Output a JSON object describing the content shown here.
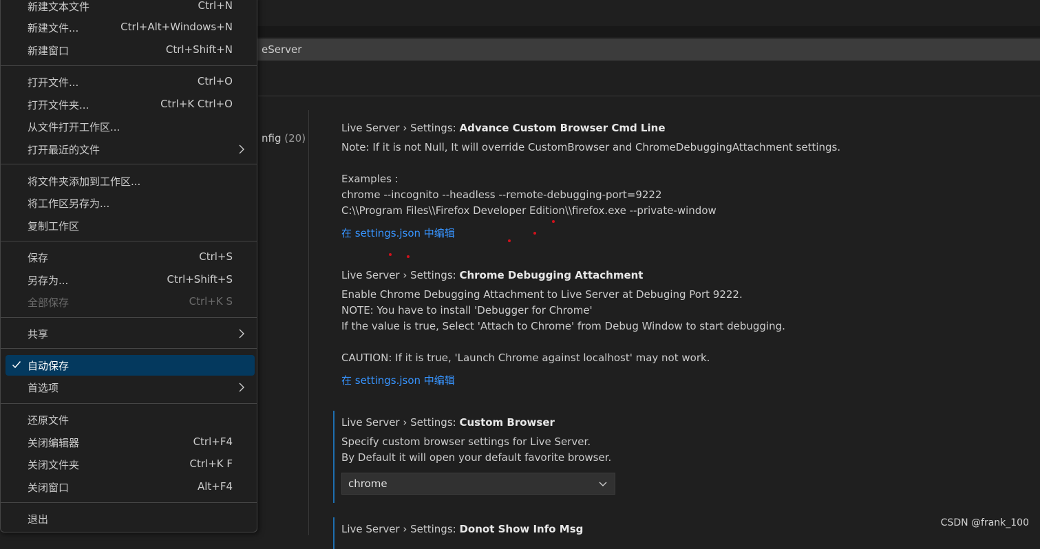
{
  "search": {
    "value_fragment": "eServer"
  },
  "toc": {
    "label_fragment": "nfig",
    "count": "(20)"
  },
  "settings": [
    {
      "category": "Live Server › Settings: ",
      "name": "Advance Custom Browser Cmd Line",
      "desc": [
        "Note: If it is not Null, It will override CustomBrowser and ChromeDebuggingAttachment settings.",
        "",
        "Examples :",
        "chrome --incognito --headless --remote-debugging-port=9222",
        "C:\\\\Program Files\\\\Firefox Developer Edition\\\\firefox.exe --private-window"
      ],
      "link": "在 settings.json 中编辑"
    },
    {
      "category": "Live Server › Settings: ",
      "name": "Chrome Debugging Attachment",
      "desc": [
        "Enable Chrome Debugging Attachment to Live Server at Debuging Port 9222.",
        "NOTE: You have to install 'Debugger for Chrome'",
        "If the value is true, Select 'Attach to Chrome' from Debug Window to start debugging.",
        "",
        "CAUTION: If it is true, 'Launch Chrome against localhost' may not work."
      ],
      "link": "在 settings.json 中编辑"
    },
    {
      "category": "Live Server › Settings: ",
      "name": "Custom Browser",
      "desc": [
        "Specify custom browser settings for Live Server.",
        "By Default it will open your default favorite browser."
      ],
      "dropdown_value": "chrome"
    },
    {
      "category": "Live Server › Settings: ",
      "name": "Donot Show Info Msg",
      "desc": []
    }
  ],
  "menu": {
    "items": [
      {
        "label": "新建文本文件",
        "shortcut": "Ctrl+N"
      },
      {
        "label": "新建文件...",
        "shortcut": "Ctrl+Alt+Windows+N"
      },
      {
        "label": "新建窗口",
        "shortcut": "Ctrl+Shift+N"
      },
      {
        "label": "打开文件...",
        "shortcut": "Ctrl+O"
      },
      {
        "label": "打开文件夹...",
        "shortcut": "Ctrl+K Ctrl+O"
      },
      {
        "label": "从文件打开工作区...",
        "shortcut": ""
      },
      {
        "label": "打开最近的文件",
        "shortcut": "",
        "submenu": true
      },
      {
        "label": "将文件夹添加到工作区...",
        "shortcut": ""
      },
      {
        "label": "将工作区另存为...",
        "shortcut": ""
      },
      {
        "label": "复制工作区",
        "shortcut": ""
      },
      {
        "label": "保存",
        "shortcut": "Ctrl+S"
      },
      {
        "label": "另存为...",
        "shortcut": "Ctrl+Shift+S"
      },
      {
        "label": "全部保存",
        "shortcut": "Ctrl+K S",
        "disabled": true
      },
      {
        "label": "共享",
        "shortcut": "",
        "submenu": true
      },
      {
        "label": "自动保存",
        "shortcut": "",
        "checked": true
      },
      {
        "label": "首选项",
        "shortcut": "",
        "submenu": true
      },
      {
        "label": "还原文件",
        "shortcut": ""
      },
      {
        "label": "关闭编辑器",
        "shortcut": "Ctrl+F4"
      },
      {
        "label": "关闭文件夹",
        "shortcut": "Ctrl+K F"
      },
      {
        "label": "关闭窗口",
        "shortcut": "Alt+F4"
      },
      {
        "label": "退出",
        "shortcut": ""
      }
    ]
  },
  "watermark": "CSDN @frank_100",
  "colors": {
    "link": "#3794ff",
    "selection": "#04395e",
    "accent_bar": "#1e6fb0",
    "dots": "#d0121b"
  },
  "icons": {
    "check": "check-icon",
    "submenu": "chevron-right-icon",
    "dropdown": "chevron-down-icon"
  }
}
